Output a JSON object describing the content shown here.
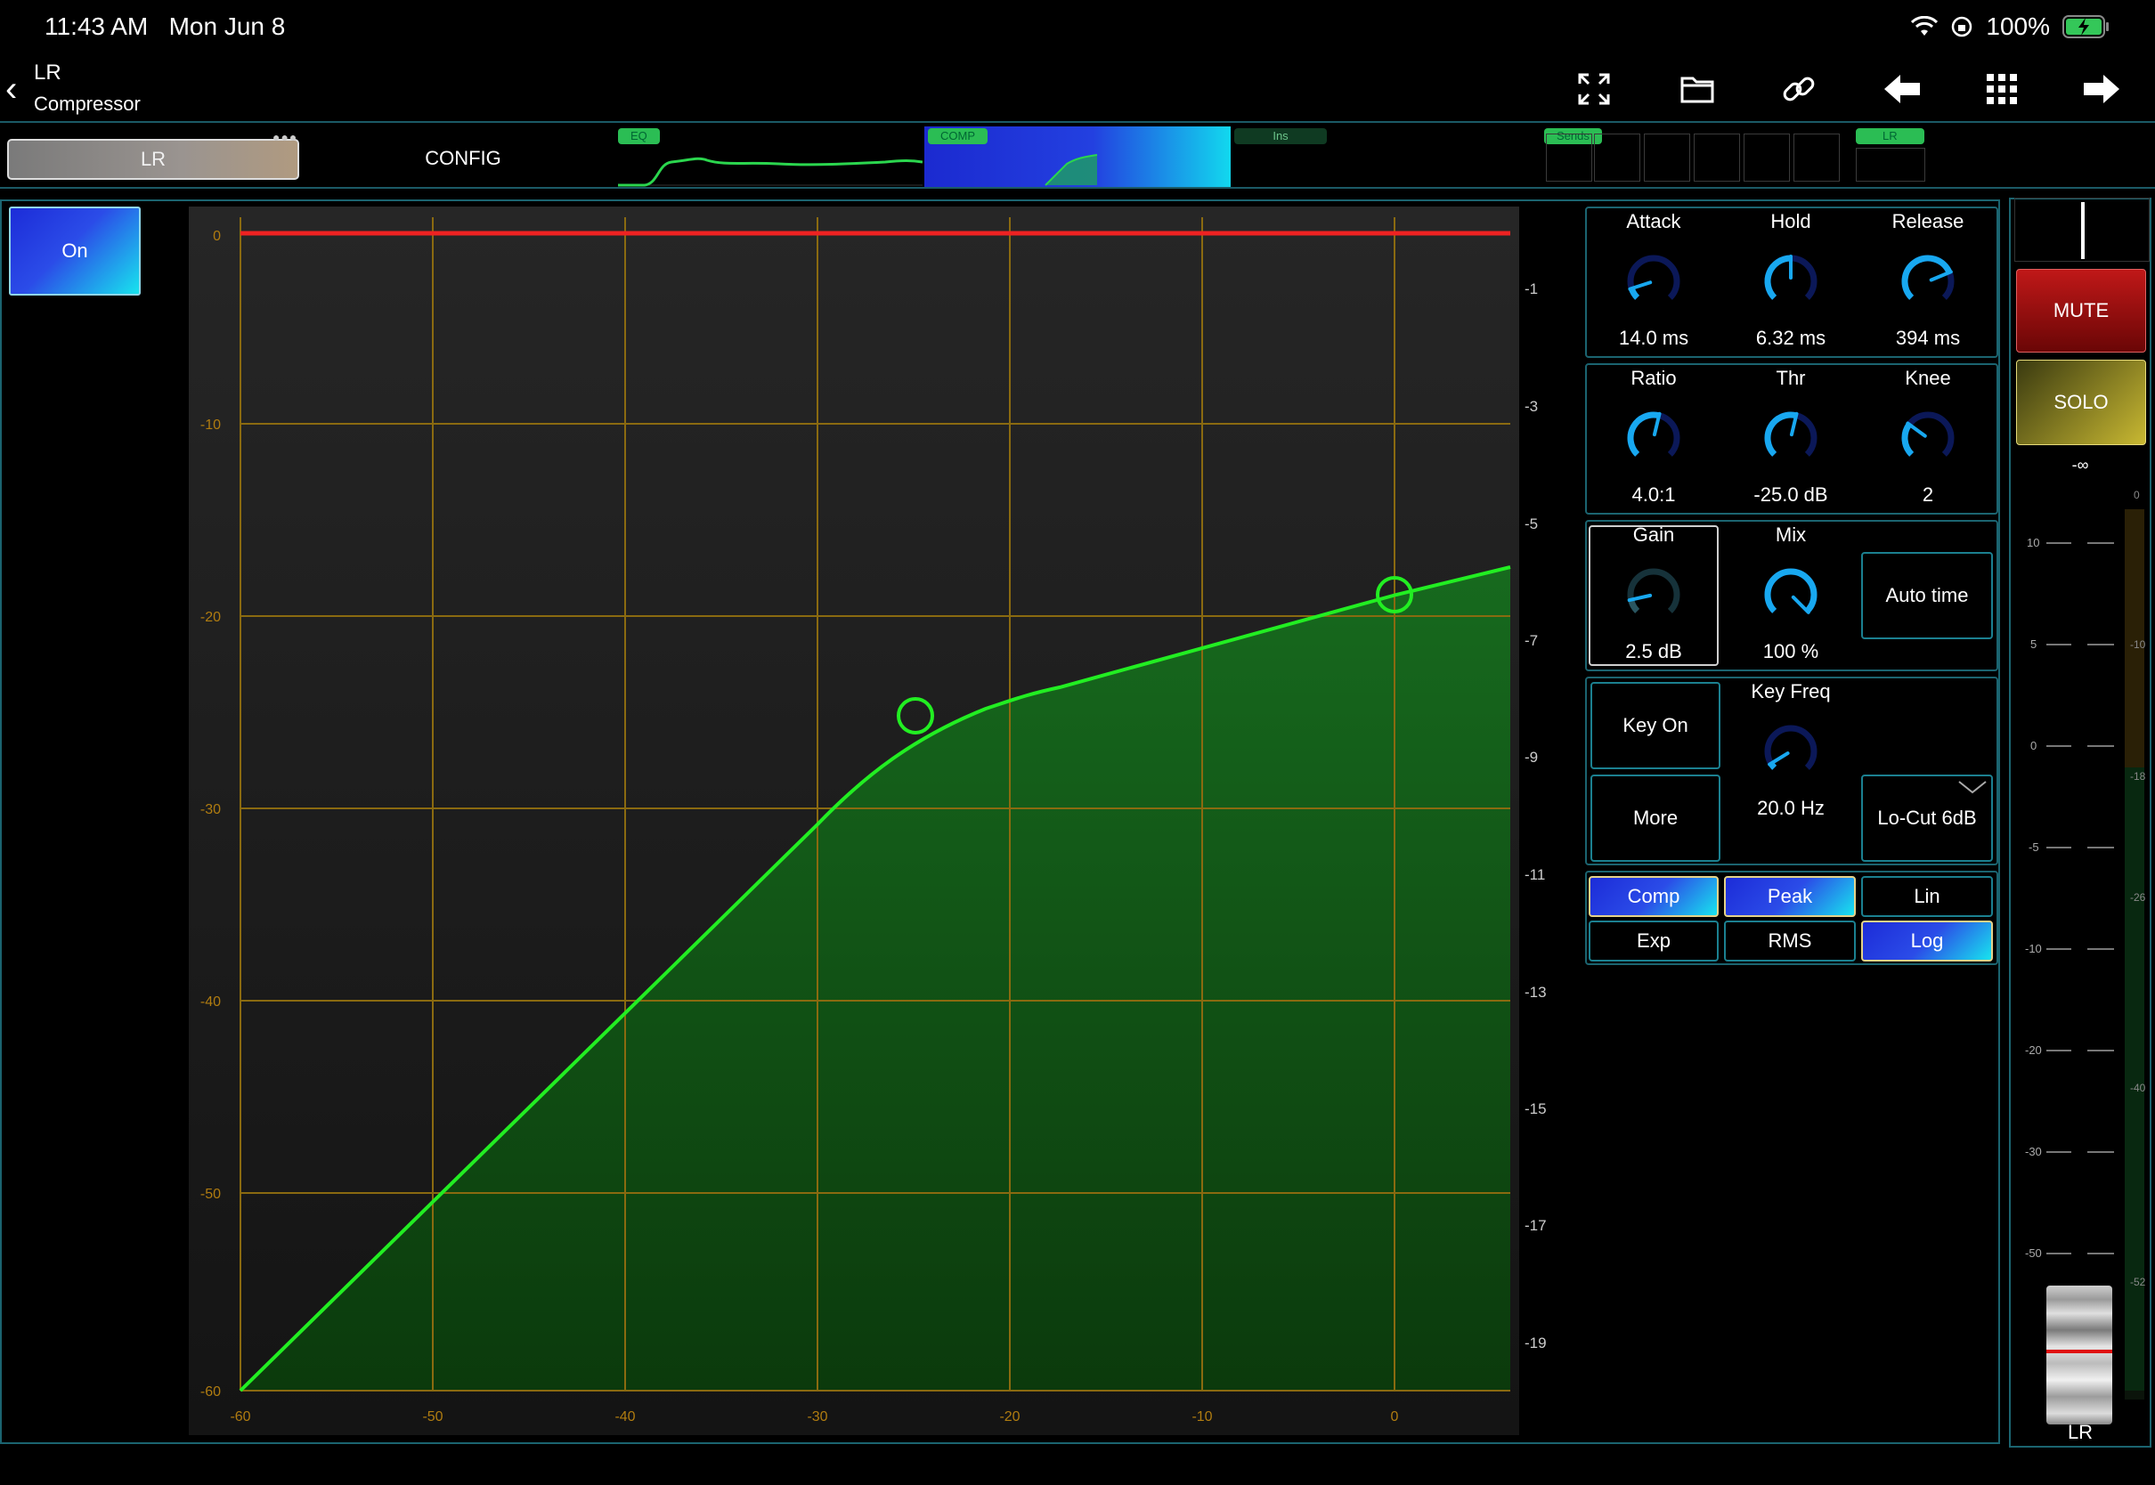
{
  "status_bar": {
    "time": "11:43 AM",
    "date": "Mon Jun 8",
    "battery": "100%"
  },
  "header": {
    "title": "LR",
    "subtitle": "Compressor"
  },
  "toolbar": {
    "icons": [
      "fullscreen-icon",
      "folder-icon",
      "link-icon",
      "back-arrow-icon",
      "grid-icon",
      "forward-arrow-icon"
    ]
  },
  "strip": {
    "channel_tab": "LR",
    "config_tab": "CONFIG",
    "eq_tag": "EQ",
    "comp_tag": "COMP",
    "ins_tag": "Ins",
    "sends_tag": "Sends",
    "lr_tag": "LR"
  },
  "on_button": "On",
  "graph": {
    "y_left_labels": [
      "0",
      "-10",
      "-20",
      "-30",
      "-40",
      "-50",
      "-60"
    ],
    "x_labels": [
      "-60",
      "-50",
      "-40",
      "-30",
      "-20",
      "-10",
      "0"
    ],
    "y_right_labels": [
      "-1",
      "-3",
      "-5",
      "-7",
      "-9",
      "-11",
      "-13",
      "-15",
      "-17",
      "-19"
    ]
  },
  "knobs_row1": [
    {
      "label": "Attack",
      "value": "14.0 ms",
      "level": 0.1
    },
    {
      "label": "Hold",
      "value": "6.32 ms",
      "level": 0.5
    },
    {
      "label": "Release",
      "value": "394 ms",
      "level": 0.75
    }
  ],
  "knobs_row2": [
    {
      "label": "Ratio",
      "value": "4.0:1",
      "level": 0.55
    },
    {
      "label": "Thr",
      "value": "-25.0 dB",
      "level": 0.55
    },
    {
      "label": "Knee",
      "value": "2",
      "level": 0.3
    }
  ],
  "knobs_row3": [
    {
      "label": "Gain",
      "value": "2.5 dB",
      "level": 0.12
    },
    {
      "label": "Mix",
      "value": "100 %",
      "level": 1.0
    }
  ],
  "auto_time": "Auto time",
  "key": {
    "key_on": "Key On",
    "more": "More",
    "freq_label": "Key Freq",
    "freq_value": "20.0 Hz",
    "freq_level": 0.05,
    "filter": "Lo-Cut 6dB"
  },
  "modes": {
    "comp": "Comp",
    "peak": "Peak",
    "lin": "Lin",
    "exp": "Exp",
    "rms": "RMS",
    "log": "Log"
  },
  "fader": {
    "mute": "MUTE",
    "solo": "SOLO",
    "level": "-∞",
    "channel": "LR",
    "scale_left": [
      "10",
      "5",
      "0",
      "-5",
      "-10",
      "-20",
      "-30",
      "-50"
    ],
    "scale_right": [
      "0",
      "-10",
      "-18",
      "-26",
      "-40",
      "-52"
    ]
  },
  "colors": {
    "accent": "#1b6470",
    "curve": "#22ee22",
    "threshold_line": "#ee2222",
    "grid": "#8a6a10"
  }
}
